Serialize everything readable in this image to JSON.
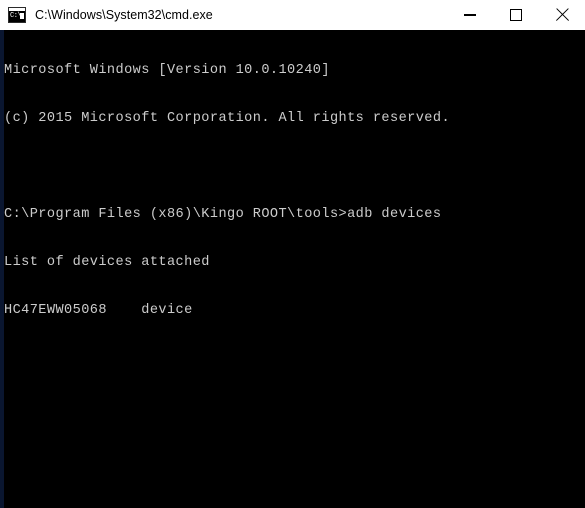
{
  "window": {
    "title": "C:\\Windows\\System32\\cmd.exe",
    "icon": "cmd-console-icon",
    "icon_prompt_text": "C:\\",
    "titlebar_bg": "#ffffff",
    "titlebar_fg": "#000000",
    "console_bg": "#000000",
    "console_fg": "#cccccc",
    "left_edge_color": "#0a1630"
  },
  "controls": {
    "minimize_label": "—",
    "minimize_name": "Minimize",
    "maximize_label": "□",
    "maximize_name": "Maximize",
    "close_label": "✕",
    "close_name": "Close"
  },
  "console": {
    "lines": [
      "Microsoft Windows [Version 10.0.10240]",
      "(c) 2015 Microsoft Corporation. All rights reserved.",
      "",
      "C:\\Program Files (x86)\\Kingo ROOT\\tools>adb devices",
      "List of devices attached",
      "HC47EWW05068    device"
    ],
    "prompt_path": "C:\\Program Files (x86)\\Kingo ROOT\\tools",
    "command": "adb devices",
    "device_serial": "HC47EWW05068",
    "device_state": "device"
  }
}
